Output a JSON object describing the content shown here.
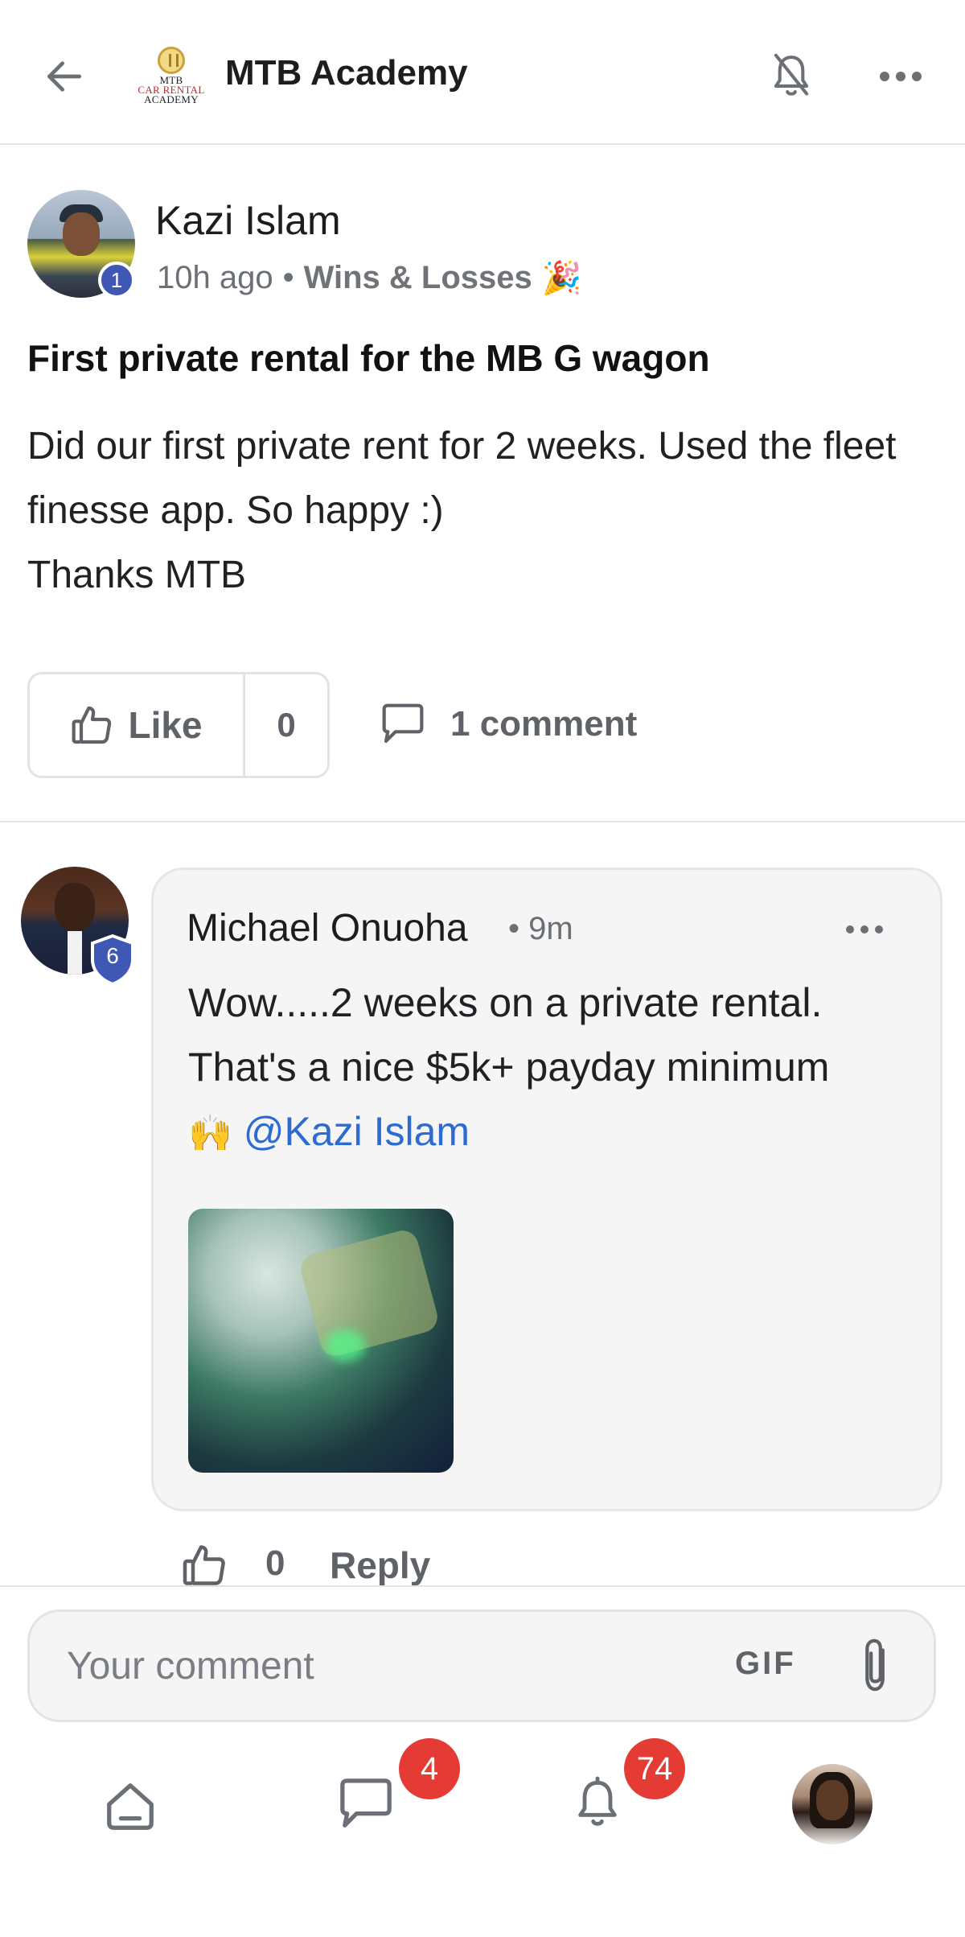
{
  "header": {
    "title": "MTB Academy",
    "logo_text": [
      "MTB",
      "CAR RENTAL",
      "ACADEMY"
    ],
    "icons": {
      "back": "arrow-left-icon",
      "mute": "bell-off-icon",
      "more": "more-horizontal-icon"
    }
  },
  "post": {
    "author": "Kazi Islam",
    "author_level": "1",
    "time": "10h ago",
    "category": "Wins & Losses",
    "category_emoji": "🎉",
    "title": "First private rental for the MB G wagon",
    "body_lines": [
      "Did our first private rent for 2 weeks. Used the fleet finesse app. So happy :)",
      "Thanks MTB"
    ],
    "like_label": "Like",
    "like_count": "0",
    "comment_count_label": "1 comment"
  },
  "comment": {
    "author": "Michael Onuoha",
    "author_level": "6",
    "time": "9m",
    "body_line1": "Wow.....2 weeks on a private rental.",
    "body_line2": "That's a nice $5k+ payday minimum",
    "emoji": "🙌",
    "mention": "@Kazi Islam",
    "like_count": "0",
    "reply_label": "Reply"
  },
  "composer": {
    "placeholder": "Your comment",
    "gif_label": "GIF"
  },
  "bottom_nav": {
    "items": [
      {
        "name": "home",
        "icon": "home-icon"
      },
      {
        "name": "chat",
        "icon": "chat-icon",
        "badge": "4"
      },
      {
        "name": "notifications",
        "icon": "bell-icon",
        "badge": "74"
      },
      {
        "name": "profile",
        "icon": "avatar"
      }
    ]
  },
  "colors": {
    "level_badge": "#3f57b5",
    "mention": "#2c6bd1",
    "notification_badge": "#e43c35",
    "bubble": "#f5f5f5"
  }
}
